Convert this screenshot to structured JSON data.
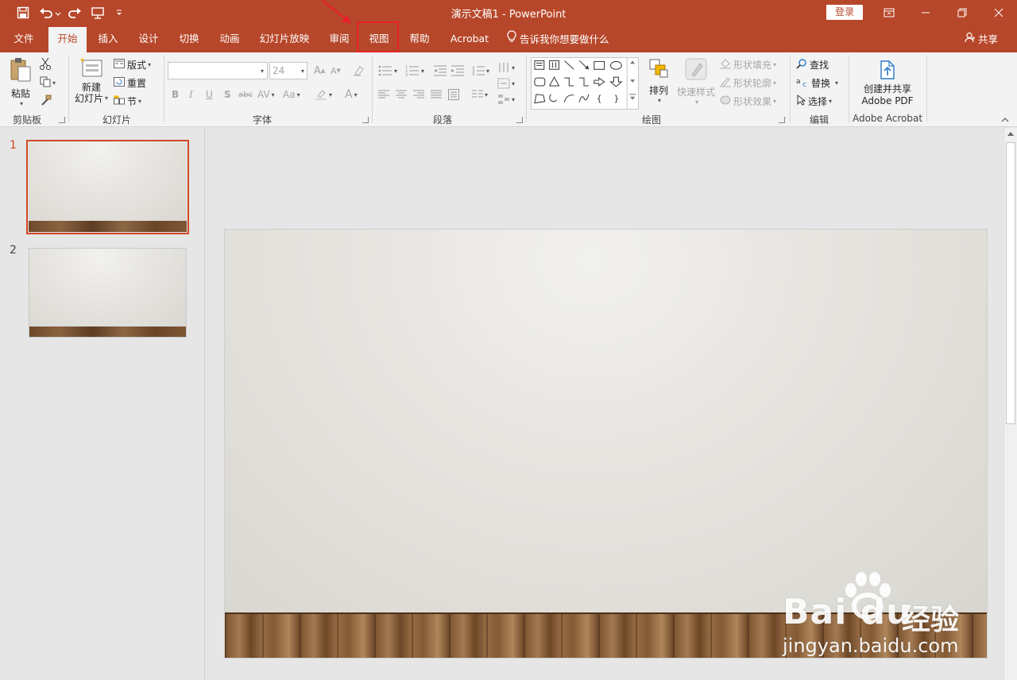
{
  "window": {
    "title": "演示文稿1 - PowerPoint",
    "login_label": "登录",
    "share_label": "共享"
  },
  "tabs": [
    {
      "label": "文件"
    },
    {
      "label": "开始"
    },
    {
      "label": "插入"
    },
    {
      "label": "设计"
    },
    {
      "label": "切换"
    },
    {
      "label": "动画"
    },
    {
      "label": "幻灯片放映"
    },
    {
      "label": "审阅"
    },
    {
      "label": "视图"
    },
    {
      "label": "帮助"
    },
    {
      "label": "Acrobat"
    },
    {
      "label": "告诉我你想要做什么"
    }
  ],
  "active_tab": "开始",
  "highlighted_tab": "视图",
  "ribbon": {
    "clipboard": {
      "paste_label": "粘贴",
      "group_label": "剪贴板"
    },
    "slides": {
      "new_slide_line1": "新建",
      "new_slide_line2": "幻灯片",
      "layout_label": "版式",
      "reset_label": "重置",
      "section_label": "节",
      "group_label": "幻灯片"
    },
    "font": {
      "font_name": "",
      "font_size": "24",
      "group_label": "字体"
    },
    "paragraph": {
      "group_label": "段落"
    },
    "drawing": {
      "arrange_label": "排列",
      "quick_styles_label": "快速样式",
      "shape_fill_label": "形状填充",
      "shape_outline_label": "形状轮廓",
      "shape_effects_label": "形状效果",
      "group_label": "绘图"
    },
    "editing": {
      "find_label": "查找",
      "replace_label": "替换",
      "select_label": "选择",
      "group_label": "编辑"
    },
    "acrobat": {
      "create_line1": "创建并共享",
      "create_line2": "Adobe PDF",
      "group_label": "Adobe Acrobat"
    }
  },
  "thumbnails": [
    {
      "number": "1",
      "selected": true
    },
    {
      "number": "2",
      "selected": false
    }
  ],
  "watermark": {
    "brand": "Bai du",
    "brand_suffix": "经验",
    "url": "jingyan.baidu.com"
  },
  "colors": {
    "accent": "#b7472a",
    "highlight_box": "#e8202a",
    "selected_thumb": "#d24726"
  }
}
